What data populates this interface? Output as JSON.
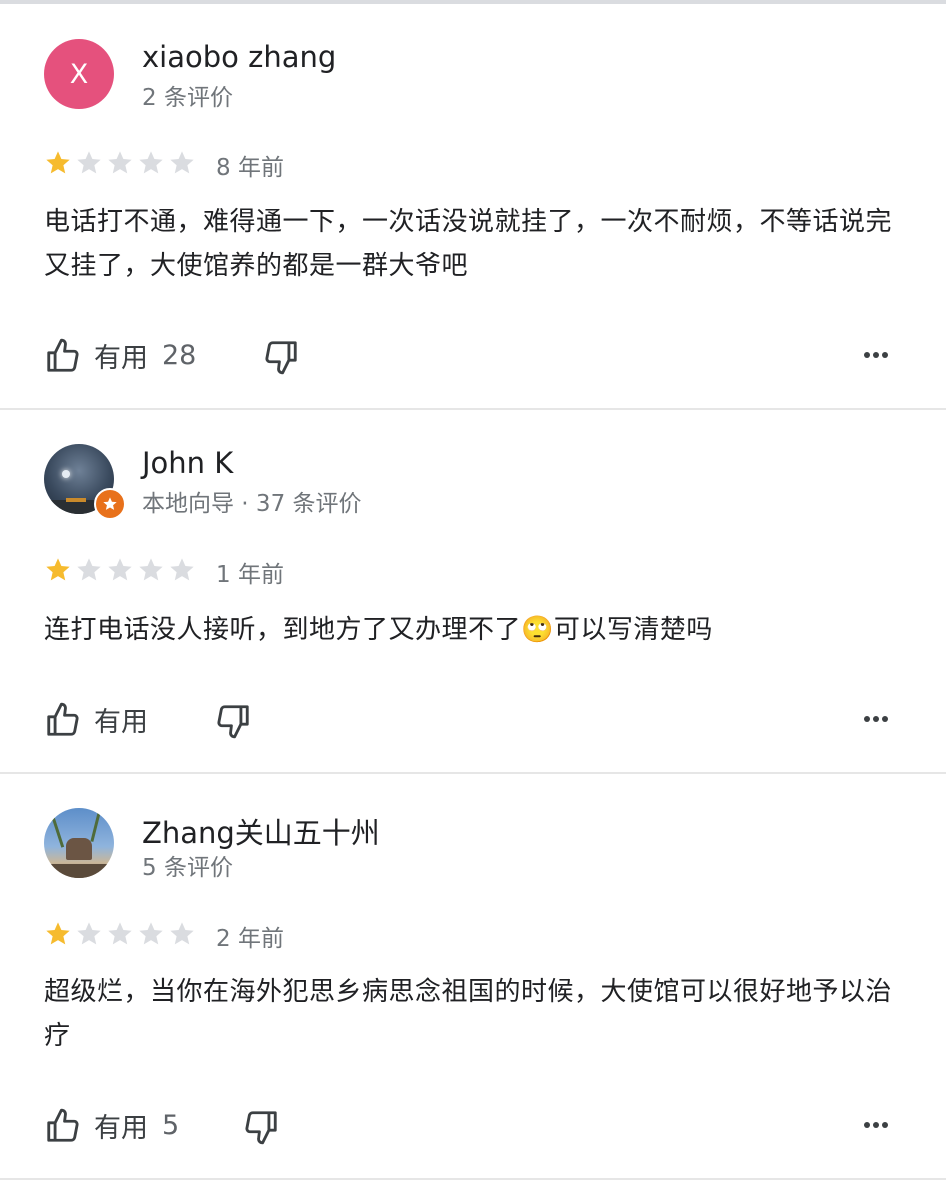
{
  "reviews": [
    {
      "author": "xiaobo zhang",
      "avatar_letter": "X",
      "meta": "2 条评价",
      "rating": 1,
      "time": "8 年前",
      "text": "电话打不通，难得通一下，一次话没说就挂了，一次不耐烦，不等话说完又挂了，大使馆养的都是一群大爷吧",
      "helpful_label": "有用",
      "helpful_count": "28"
    },
    {
      "author": "John K",
      "meta": "本地向导 · 37 条评价",
      "rating": 1,
      "time": "1 年前",
      "text": "连打电话没人接听，到地方了又办理不了🙄可以写清楚吗",
      "helpful_label": "有用",
      "helpful_count": ""
    },
    {
      "author": "Zhang关山五十州",
      "meta": "5 条评价",
      "rating": 1,
      "time": "2 年前",
      "text": "超级烂，当你在海外犯思乡病思念祖国的时候，大使馆可以很好地予以治疗",
      "helpful_label": "有用",
      "helpful_count": "5"
    }
  ],
  "colors": {
    "star_filled": "#f6bb2e",
    "star_empty": "#dadce0",
    "avatar_x": "#e5517d",
    "local_guide_badge": "#e8711b"
  },
  "icons": [
    "thumb-up-icon",
    "thumb-down-icon",
    "more-icon",
    "star-icon",
    "local-guide-badge-icon"
  ]
}
